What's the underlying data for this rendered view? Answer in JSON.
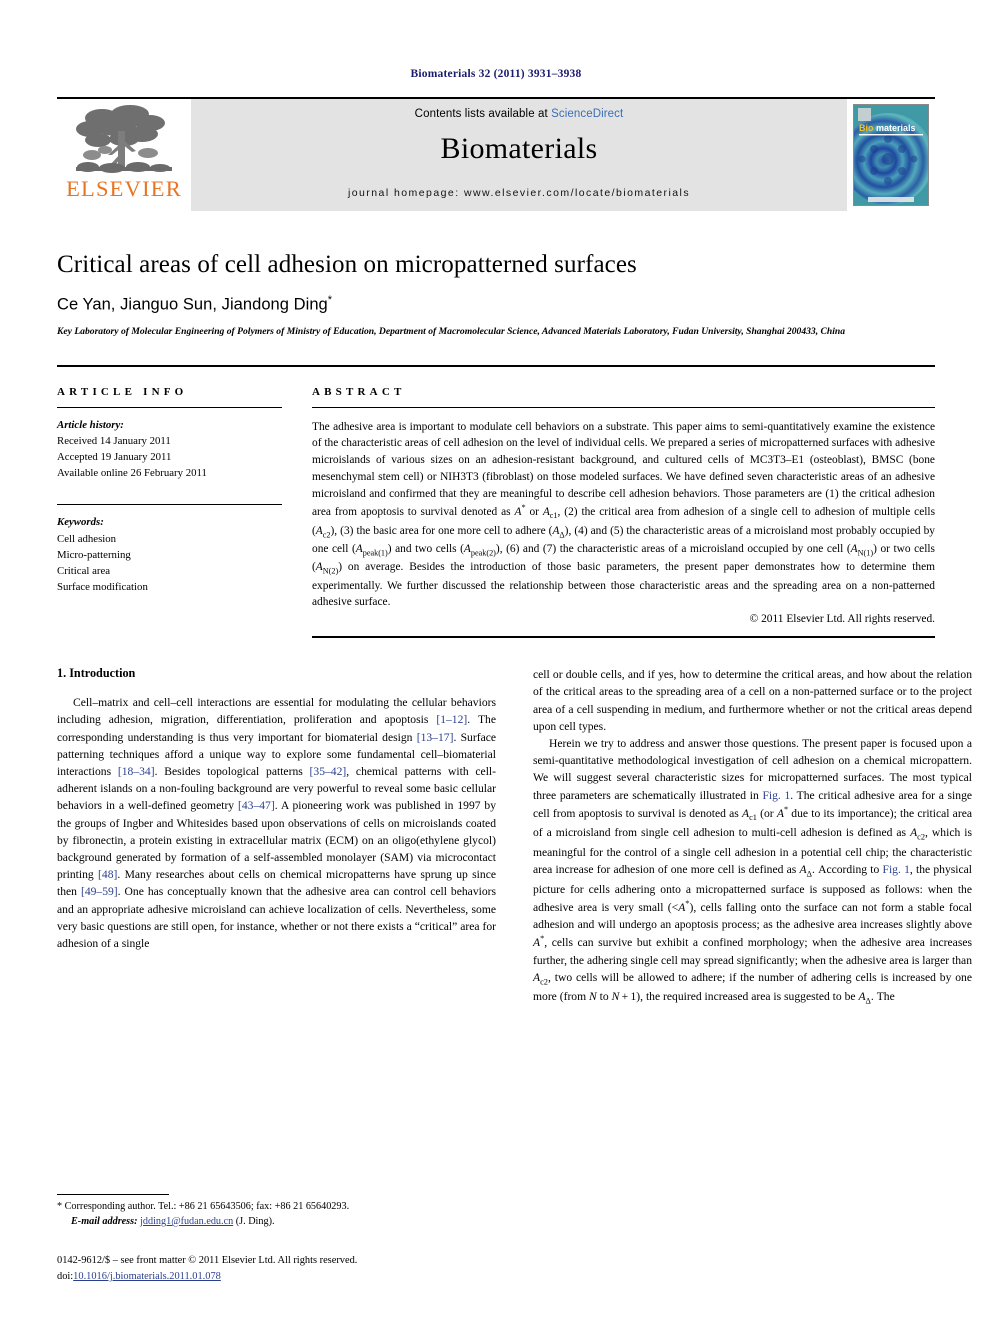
{
  "running_head": "Biomaterials 32 (2011) 3931–3938",
  "masthead": {
    "publisher": "ELSEVIER",
    "contents_prefix": "Contents lists available at ",
    "contents_link": "ScienceDirect",
    "journal_name": "Biomaterials",
    "homepage": "journal homepage: www.elsevier.com/locate/biomaterials",
    "cover_title": "Biomaterials"
  },
  "title": "Critical areas of cell adhesion on micropatterned surfaces",
  "authors": "Ce Yan, Jianguo Sun, Jiandong Ding",
  "corresponding_marker": "*",
  "affiliation": "Key Laboratory of Molecular Engineering of Polymers of Ministry of Education, Department of Macromolecular Science, Advanced Materials Laboratory, Fudan University, Shanghai 200433, China",
  "article_info": {
    "heading": "ARTICLE INFO",
    "history_label": "Article history:",
    "history": [
      "Received 14 January 2011",
      "Accepted 19 January 2011",
      "Available online 26 February 2011"
    ],
    "keywords_label": "Keywords:",
    "keywords": [
      "Cell adhesion",
      "Micro-patterning",
      "Critical area",
      "Surface modification"
    ]
  },
  "abstract": {
    "heading": "ABSTRACT",
    "copyright": "© 2011 Elsevier Ltd. All rights reserved."
  },
  "introduction": {
    "heading": "1. Introduction"
  },
  "footnote": {
    "corresponding": "* Corresponding author. Tel.: +86 21 65643506; fax: +86 21 65640293.",
    "email_label": "E-mail address:",
    "email": "jdding1@fudan.edu.cn",
    "email_suffix": "(J. Ding)."
  },
  "footer": {
    "issn_line": "0142-9612/$ – see front matter © 2011 Elsevier Ltd. All rights reserved.",
    "doi_label": "doi:",
    "doi": "10.1016/j.biomaterials.2011.01.078"
  },
  "colors": {
    "elsevier_orange": "#E87422",
    "link_blue": "#2a3f8f",
    "sciencedirect_blue": "#3b6fb6",
    "running_head_navy": "#1a1a6e",
    "banner_gray": "#e3e3e3"
  }
}
